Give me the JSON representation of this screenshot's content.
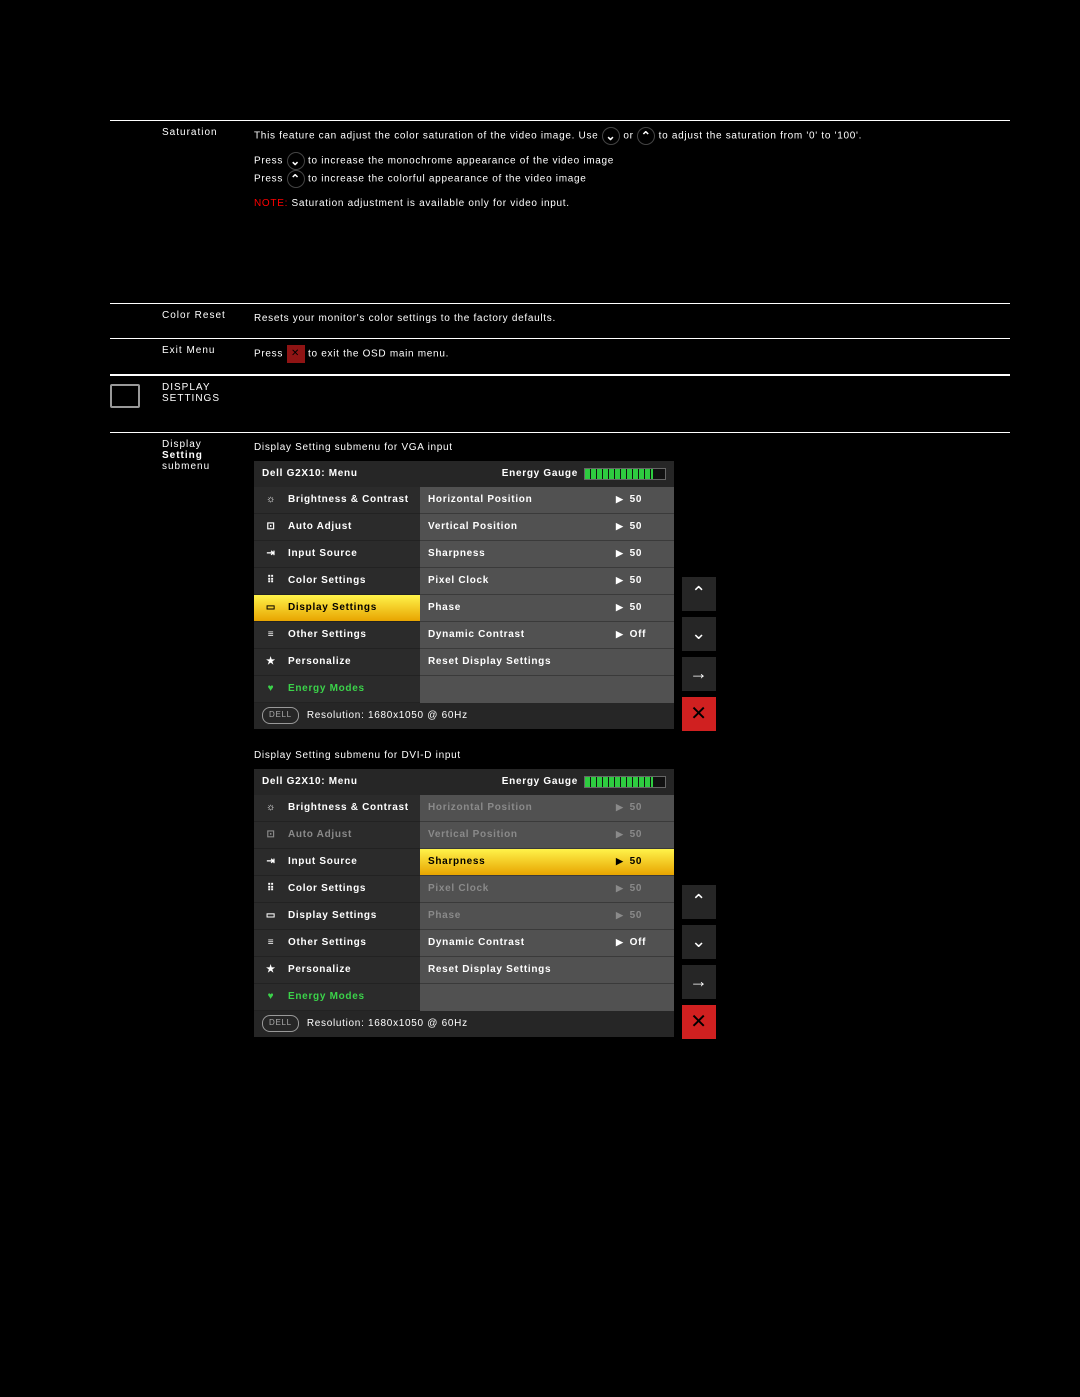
{
  "rows": {
    "saturation": {
      "label": "Saturation",
      "desc1_a": "This feature can adjust the color saturation of the video image. Use",
      "desc1_b": "or",
      "desc1_c": "to adjust the saturation from '0' to '100'.",
      "desc2_a": "Press",
      "desc2_b": "to increase the monochrome appearance of the video image",
      "desc3_a": "Press",
      "desc3_b": "to increase the colorful appearance of the video image",
      "note_prefix": "NOTE:",
      "note_text": " Saturation adjustment is available only for video input."
    },
    "color_reset": {
      "label": "Color Reset",
      "desc": "Resets your monitor's color settings to the factory defaults."
    },
    "exit_menu": {
      "label": "Exit Menu",
      "desc_a": "Press",
      "desc_b": "to exit the OSD main menu."
    },
    "display_settings_label": "DISPLAY SETTINGS",
    "display_setting_submenu": {
      "label_line1": "Display",
      "label_line2": "Setting",
      "label_line3": "submenu",
      "vga_heading": "Display Setting submenu for VGA input",
      "dvi_heading": "Display Setting submenu for DVI-D input"
    }
  },
  "osd": {
    "title": "Dell G2X10: Menu",
    "energy_label": "Energy Gauge",
    "menu_items": [
      {
        "label": "Brightness & Contrast"
      },
      {
        "label": "Auto Adjust"
      },
      {
        "label": "Input Source"
      },
      {
        "label": "Color Settings"
      },
      {
        "label": "Display Settings"
      },
      {
        "label": "Other Settings"
      },
      {
        "label": "Personalize"
      },
      {
        "label": "Energy Modes"
      }
    ],
    "options": [
      {
        "label": "Horizontal Position",
        "value": "50"
      },
      {
        "label": "Vertical Position",
        "value": "50"
      },
      {
        "label": "Sharpness",
        "value": "50"
      },
      {
        "label": "Pixel Clock",
        "value": "50"
      },
      {
        "label": "Phase",
        "value": "50"
      },
      {
        "label": "Dynamic Contrast",
        "value": "Off"
      },
      {
        "label": "Reset Display Settings",
        "value": ""
      }
    ],
    "resolution_label": "Resolution: 1680x1050 @ 60Hz"
  },
  "nav": {
    "up": "⌃",
    "down": "⌄",
    "right": "→",
    "close": "✕"
  },
  "btn_glyphs": {
    "down": "⌄",
    "up": "⌃",
    "close": "✕"
  }
}
